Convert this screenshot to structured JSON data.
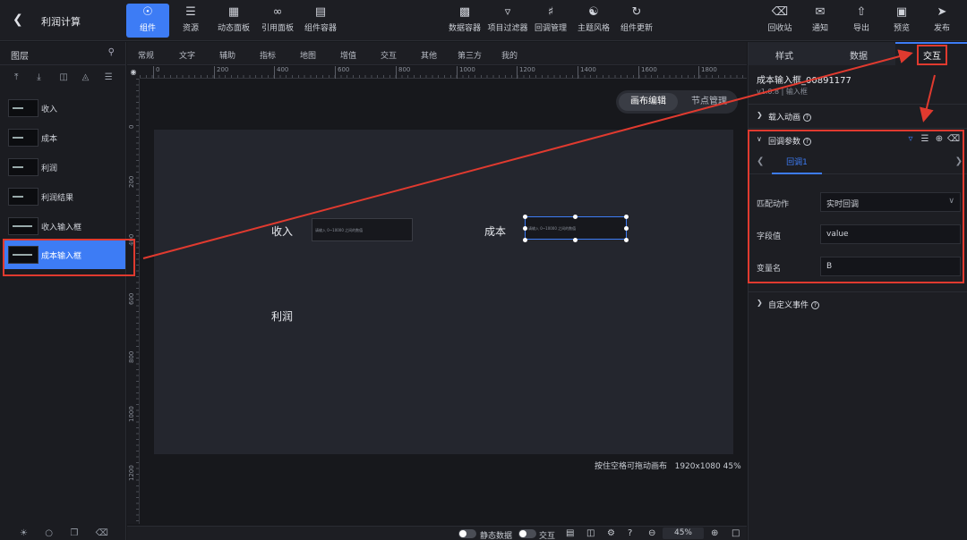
{
  "header": {
    "title": "利润计算",
    "left_tools": [
      {
        "label": "组件",
        "icon": "component-icon",
        "active": true
      },
      {
        "label": "资源",
        "icon": "layers-stack-icon"
      },
      {
        "label": "动态面板",
        "icon": "dashboard-icon"
      },
      {
        "label": "引用面板",
        "icon": "link-icon"
      },
      {
        "label": "组件容器",
        "icon": "container-icon"
      }
    ],
    "center_tools": [
      {
        "label": "数据容器",
        "icon": "bar-chart-icon"
      },
      {
        "label": "项目过滤器",
        "icon": "filter-icon"
      },
      {
        "label": "回调管理",
        "icon": "sliders-icon"
      },
      {
        "label": "主题风格",
        "icon": "palette-icon"
      },
      {
        "label": "组件更新",
        "icon": "refresh-icon"
      }
    ],
    "right_tools": [
      {
        "label": "回收站",
        "icon": "trash-icon"
      },
      {
        "label": "通知",
        "icon": "message-icon"
      },
      {
        "label": "导出",
        "icon": "export-icon"
      },
      {
        "label": "预览",
        "icon": "preview-icon"
      },
      {
        "label": "发布",
        "icon": "send-icon"
      }
    ]
  },
  "layers": {
    "title": "图层",
    "items": [
      {
        "label": "收入"
      },
      {
        "label": "成本"
      },
      {
        "label": "利润"
      },
      {
        "label": "利润结果"
      },
      {
        "label": "收入输入框"
      },
      {
        "label": "成本输入框",
        "selected": true
      }
    ]
  },
  "comp_tabs": [
    "常规",
    "文字",
    "辅助",
    "指标",
    "地图",
    "增值",
    "交互",
    "其他",
    "第三方",
    "我的"
  ],
  "ruler": {
    "h_labels": [
      "0",
      "200",
      "400",
      "600",
      "800",
      "1000",
      "1200",
      "1400",
      "1600",
      "1800"
    ],
    "v_labels": [
      "0",
      "200",
      "400",
      "600",
      "800",
      "1000",
      "1200"
    ]
  },
  "canvas": {
    "mode_canvas": "画布编辑",
    "mode_node": "节点管理",
    "texts": {
      "income": "收入",
      "cost": "成本",
      "profit": "利润"
    },
    "input_placeholder": "请输入 0~10000 之间的数值",
    "hint": "按住空格可拖动画布",
    "size": "1920x1080",
    "zoom_pct": "45%"
  },
  "statusbar": {
    "static_data": "静态数据",
    "interaction": "交互",
    "zoom": "45%"
  },
  "rpanel": {
    "tabs": {
      "style": "样式",
      "data": "数据",
      "interaction": "交互"
    },
    "comp_name": "成本输入框_00891177",
    "comp_version": "v1.0.8 | 输入框",
    "section_load_anim": "载入动画",
    "section_callback": "回调参数",
    "callback_tab": "回调1",
    "fields": {
      "match_action_label": "匹配动作",
      "match_action_value": "实时回调",
      "field_value_label": "字段值",
      "field_value_value": "value",
      "var_name_label": "变量名",
      "var_name_value": "B"
    },
    "section_custom_event": "自定义事件"
  },
  "colors": {
    "accent": "#3d7cf5",
    "annotation": "#e03a2f"
  }
}
